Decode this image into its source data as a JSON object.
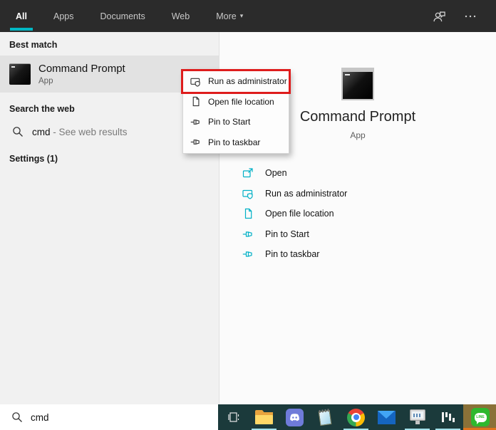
{
  "header": {
    "tabs": [
      {
        "label": "All",
        "active": true
      },
      {
        "label": "Apps",
        "active": false
      },
      {
        "label": "Documents",
        "active": false
      },
      {
        "label": "Web",
        "active": false
      },
      {
        "label": "More",
        "active": false,
        "caret": "▾"
      }
    ],
    "icons": [
      "feedback-person-icon",
      "ellipsis-icon"
    ]
  },
  "left_panel": {
    "best_match_header": "Best match",
    "best_match": {
      "title": "Command Prompt",
      "subtitle": "App",
      "icon": "command-prompt-icon"
    },
    "search_web_header": "Search the web",
    "web_item": {
      "query": "cmd",
      "hint": " - See web results",
      "icon": "search-icon"
    },
    "settings_header": "Settings (1)"
  },
  "context_menu": {
    "items": [
      {
        "label": "Run as administrator",
        "icon": "run-as-admin-icon",
        "annotated": true
      },
      {
        "label": "Open file location",
        "icon": "file-location-icon",
        "annotated": false
      },
      {
        "label": "Pin to Start",
        "icon": "pin-icon",
        "annotated": false
      },
      {
        "label": "Pin to taskbar",
        "icon": "pin-icon",
        "annotated": false
      }
    ],
    "annotation_color": "#de1c1c"
  },
  "preview": {
    "title": "Command Prompt",
    "subtitle": "App",
    "icon": "command-prompt-icon-large",
    "actions": [
      {
        "label": "Open",
        "icon": "open-icon"
      },
      {
        "label": "Run as administrator",
        "icon": "run-as-admin-icon"
      },
      {
        "label": "Open file location",
        "icon": "file-location-icon"
      },
      {
        "label": "Pin to Start",
        "icon": "pin-icon"
      },
      {
        "label": "Pin to taskbar",
        "icon": "pin-icon"
      }
    ],
    "accent_color": "#00b0c6"
  },
  "taskbar": {
    "search_value": "cmd",
    "search_icon": "search-icon",
    "background_color": "#1b3a3b",
    "apps": [
      {
        "name": "task-view",
        "running": false
      },
      {
        "name": "file-explorer",
        "running": true
      },
      {
        "name": "discord",
        "running": false
      },
      {
        "name": "notepad",
        "running": false
      },
      {
        "name": "chrome",
        "running": true
      },
      {
        "name": "mail",
        "running": false
      },
      {
        "name": "media-viewer",
        "running": true
      },
      {
        "name": "equalizer-app",
        "running": true
      },
      {
        "name": "line",
        "running": true,
        "active": true,
        "indicator_color": "#e0741d"
      }
    ]
  },
  "colors": {
    "topbar_bg": "#2b2b2b",
    "tab_accent": "#00b7c3",
    "left_panel_bg": "#f1f1f1",
    "selected_row_bg": "#e2e2e2",
    "right_panel_bg": "#fbfbfb"
  }
}
